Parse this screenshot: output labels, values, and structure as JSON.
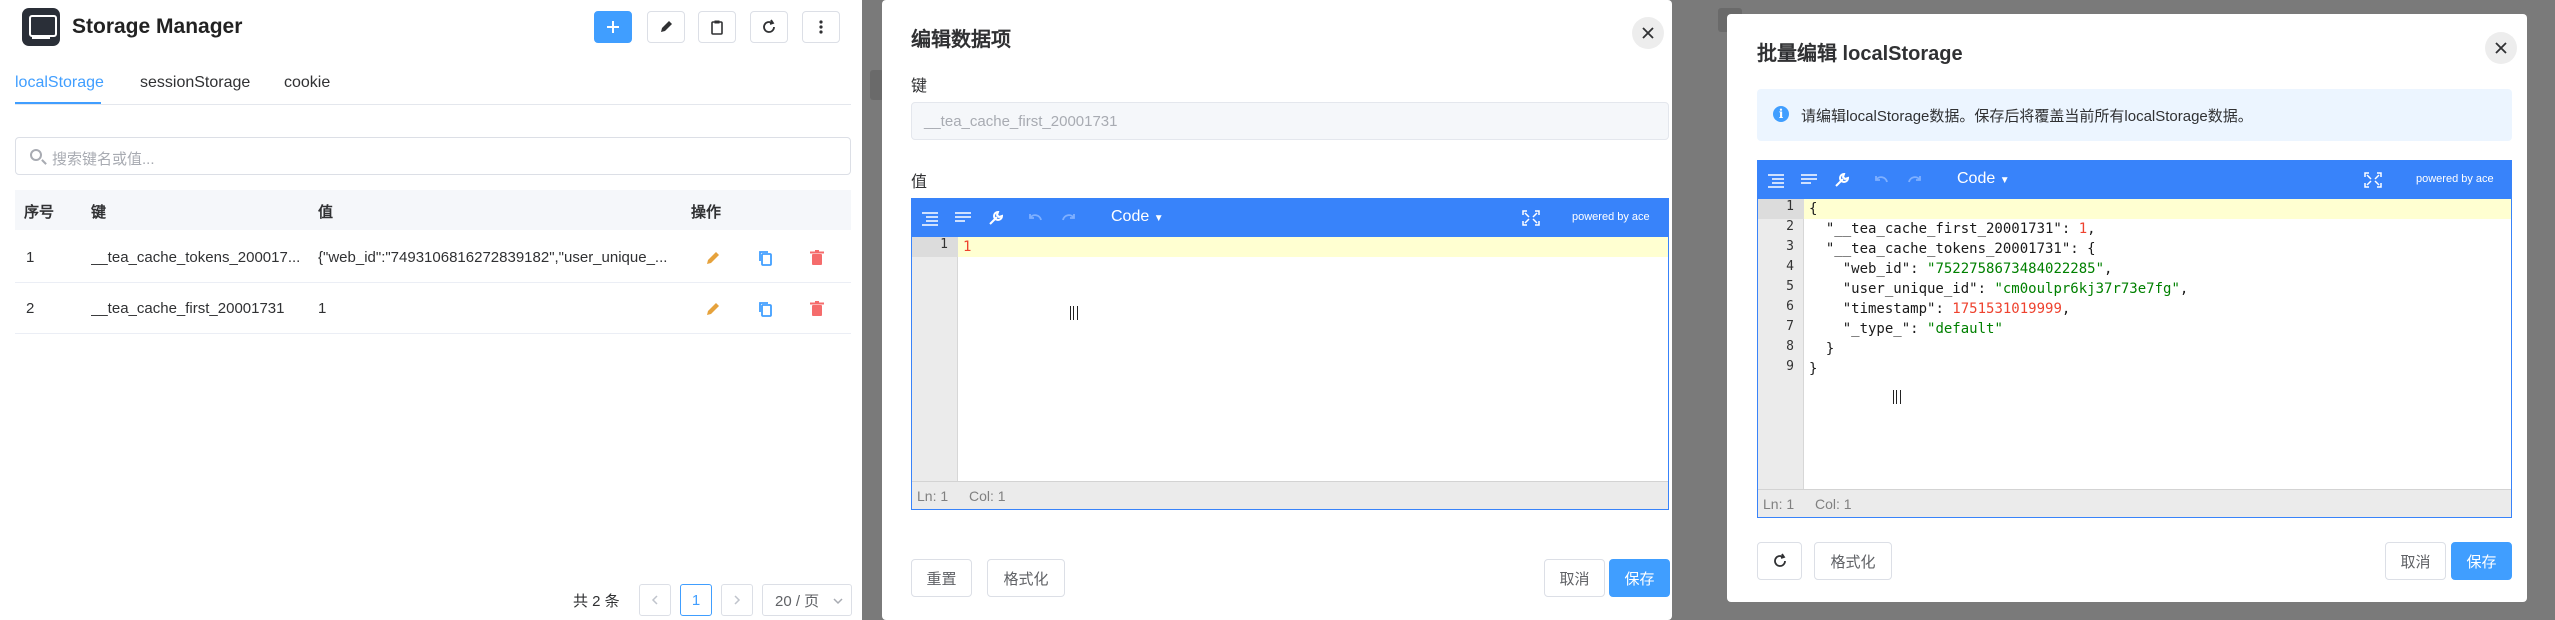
{
  "app": {
    "title": "Storage Manager",
    "tabs": [
      {
        "label": "localStorage",
        "active": true
      },
      {
        "label": "sessionStorage",
        "active": false
      },
      {
        "label": "cookie",
        "active": false
      }
    ],
    "search_placeholder": "搜索键名或值...",
    "table": {
      "headers": [
        "序号",
        "键",
        "值",
        "操作"
      ],
      "rows": [
        {
          "index": "1",
          "key": "__tea_cache_tokens_200017...",
          "value": "{\"web_id\":\"7493106816272839182\",\"user_unique_..."
        },
        {
          "index": "2",
          "key": "__tea_cache_first_20001731",
          "value": "1"
        }
      ]
    },
    "pagination": {
      "total_text": "共 2 条",
      "current_page": "1",
      "page_size": "20 / 页"
    }
  },
  "edit_dialog": {
    "title": "编辑数据项",
    "key_label": "键",
    "key_value": "__tea_cache_first_20001731",
    "value_label": "值",
    "editor": {
      "mode": "Code",
      "powered": "powered by ace",
      "lines": [
        "1"
      ],
      "status_ln": "Ln: 1",
      "status_col": "Col: 1"
    },
    "buttons": {
      "reset": "重置",
      "format": "格式化",
      "cancel": "取消",
      "save": "保存"
    }
  },
  "batch_dialog": {
    "title": "批量编辑 localStorage",
    "info": "请编辑localStorage数据。保存后将覆盖当前所有localStorage数据。",
    "editor": {
      "mode": "Code",
      "powered": "powered by ace",
      "line_numbers": [
        "1",
        "2",
        "3",
        "4",
        "5",
        "6",
        "7",
        "8",
        "9"
      ],
      "code": {
        "l1": "{",
        "l2_key": "\"__tea_cache_first_20001731\"",
        "l2_val": "1",
        "l3_key": "\"__tea_cache_tokens_20001731\"",
        "l4_key": "\"web_id\"",
        "l4_val": "\"7522758673484022285\"",
        "l5_key": "\"user_unique_id\"",
        "l5_val": "\"cm0oulpr6kj37r73e7fg\"",
        "l6_key": "\"timestamp\"",
        "l6_val": "1751531019999",
        "l7_key": "\"_type_\"",
        "l7_val": "\"default\"",
        "l8": "}",
        "l9": "}"
      },
      "status_ln": "Ln: 1",
      "status_col": "Col: 1"
    },
    "buttons": {
      "format": "格式化",
      "cancel": "取消",
      "save": "保存"
    }
  },
  "colors": {
    "primary": "#409eff",
    "editor_blue": "#3883fa",
    "danger": "#f56c6c",
    "edit_icon": "#e6a23c"
  }
}
